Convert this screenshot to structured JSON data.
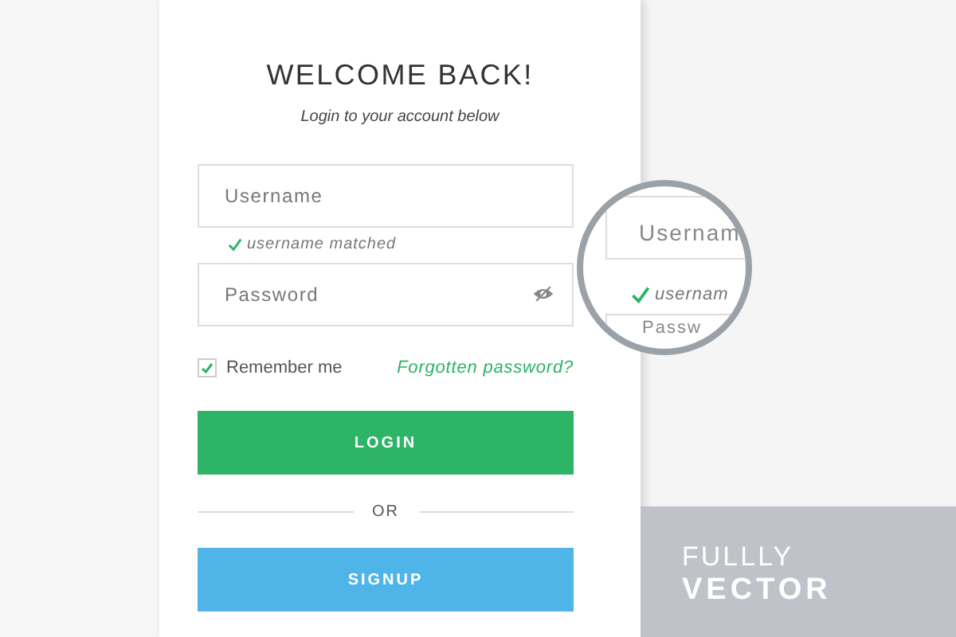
{
  "card": {
    "title": "WELCOME BACK!",
    "subtitle": "Login to your account below",
    "username": {
      "placeholder": "Username"
    },
    "username_hint": "username matched",
    "password": {
      "placeholder": "Password"
    },
    "remember": {
      "label": "Remember me",
      "checked": true
    },
    "forgot_link": "Forgotten password?",
    "login_button": "LOGIN",
    "divider_text": "OR",
    "signup_button": "SIGNUP"
  },
  "magnifier": {
    "field_text": "Usernam",
    "hint_text": "usernam",
    "field2_text": "Passw"
  },
  "banner": {
    "line_1": "FULLLY",
    "line_2": "VECTOR"
  }
}
